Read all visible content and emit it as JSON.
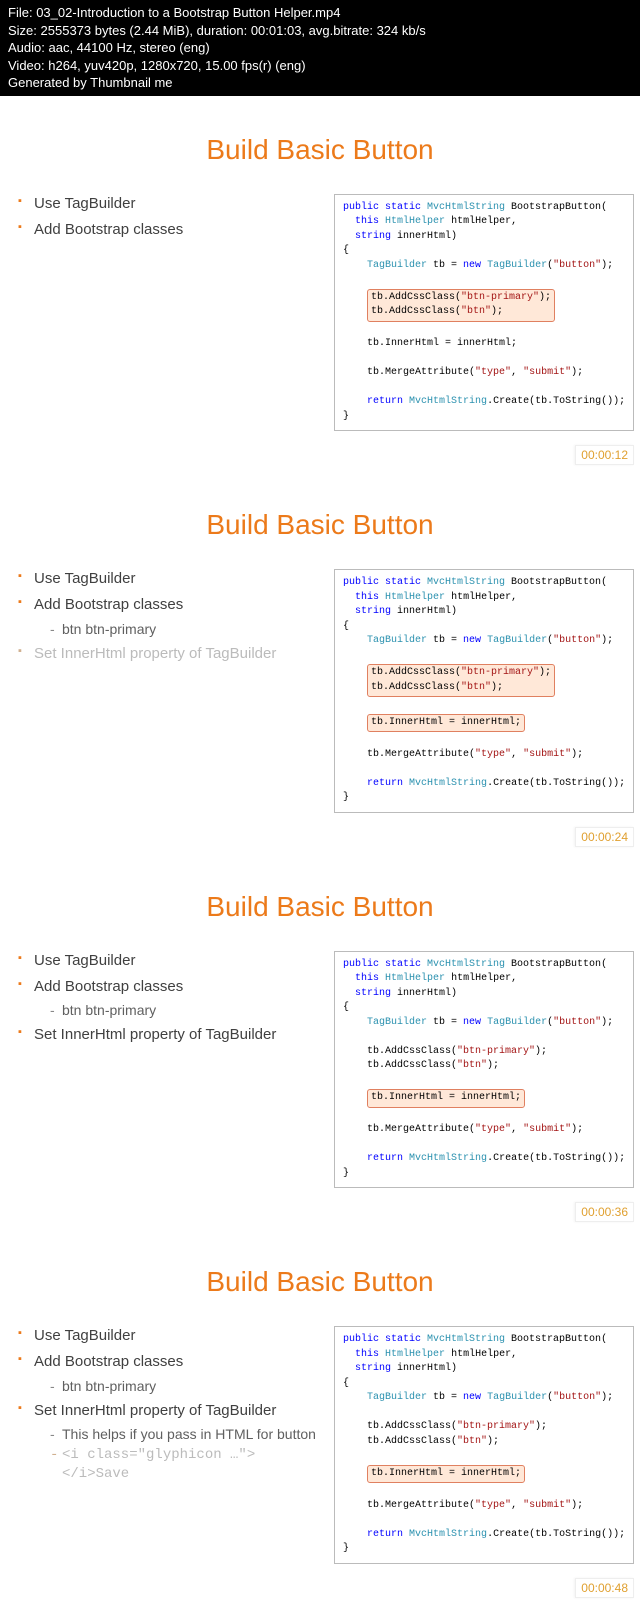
{
  "header": {
    "file_lbl": "File:",
    "file": "03_02-Introduction to a Bootstrap Button Helper.mp4",
    "size_lbl": "Size:",
    "size": "2555373 bytes (2.44 MiB), duration: 00:01:03, avg.bitrate: 324 kb/s",
    "audio_lbl": "Audio:",
    "audio": "aac, 44100 Hz, stereo (eng)",
    "video_lbl": "Video:",
    "video": "h264, yuv420p, 1280x720, 15.00 fps(r) (eng)",
    "gen": "Generated by Thumbnail me"
  },
  "slide_title": "Build Basic Button",
  "bullet": {
    "b1": "Use TagBuilder",
    "b2": "Add Bootstrap classes",
    "b2a": "btn btn-primary",
    "b3": "Set InnerHtml property of TagBuilder",
    "b3a": "This helps if you pass in HTML for button",
    "b3b": "<i class=\"glyphicon …\"></i>Save"
  },
  "code": {
    "l1a": "public static",
    "l1b": "MvcHtmlString",
    "l1c": " BootstrapButton(",
    "l2a": "this",
    "l2b": "HtmlHelper",
    "l2c": " htmlHelper,",
    "l3a": "string",
    "l3b": " innerHtml)",
    "l4": "{",
    "l5a": "TagBuilder",
    "l5b": " tb = ",
    "l5c": "new",
    "l5d": "TagBuilder",
    "l5e": "(",
    "l5f": "\"button\"",
    "l5g": ");",
    "l6a": "tb.AddCssClass(",
    "l6b": "\"btn-primary\"",
    "l6c": ");",
    "l7a": "tb.AddCssClass(",
    "l7b": "\"btn\"",
    "l7c": ");",
    "l8": "tb.InnerHtml = innerHtml;",
    "l9a": "tb.MergeAttribute(",
    "l9b": "\"type\"",
    "l9c": ", ",
    "l9d": "\"submit\"",
    "l9e": ");",
    "l10a": "return",
    "l10b": "MvcHtmlString",
    "l10c": ".Create(tb.ToString());",
    "l11": "}"
  },
  "ts": {
    "t1": "00:00:12",
    "t2": "00:00:24",
    "t3": "00:00:36",
    "t4": "00:00:48"
  }
}
